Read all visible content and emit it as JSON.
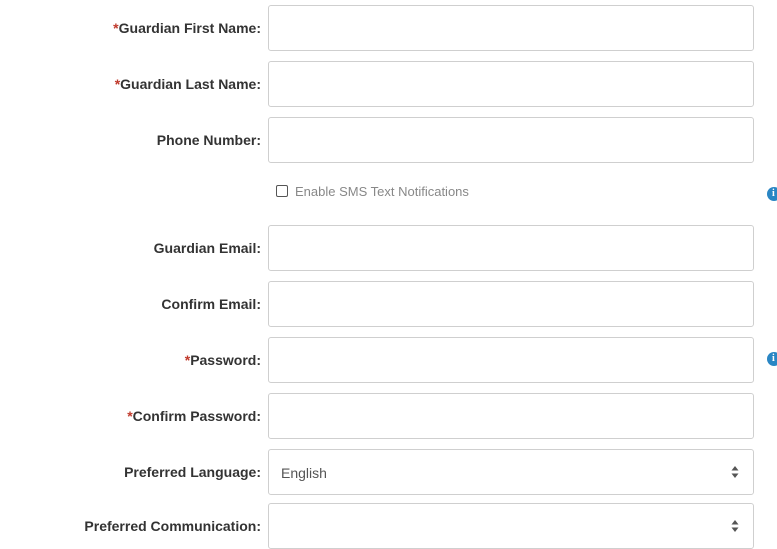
{
  "form": {
    "required_marker": "*",
    "guardian_first_name": {
      "label": "Guardian First Name:",
      "value": ""
    },
    "guardian_last_name": {
      "label": "Guardian Last Name:",
      "value": ""
    },
    "phone_number": {
      "label": "Phone Number:",
      "value": ""
    },
    "sms": {
      "label": "Enable SMS Text Notifications",
      "checked": false
    },
    "guardian_email": {
      "label": "Guardian Email:",
      "value": ""
    },
    "confirm_email": {
      "label": "Confirm Email:",
      "value": ""
    },
    "password": {
      "label": "Password:",
      "value": ""
    },
    "confirm_password": {
      "label": "Confirm Password:",
      "value": ""
    },
    "preferred_language": {
      "label": "Preferred Language:",
      "value": "English"
    },
    "preferred_communication": {
      "label": "Preferred Communication:",
      "value": ""
    }
  },
  "icons": {
    "sms_info": "info-icon",
    "password_info": "info-icon",
    "select_arrows": "sort-arrows-icon"
  },
  "colors": {
    "required": "#c0392b",
    "info": "#2a86c4",
    "border": "#cfcfcf"
  }
}
